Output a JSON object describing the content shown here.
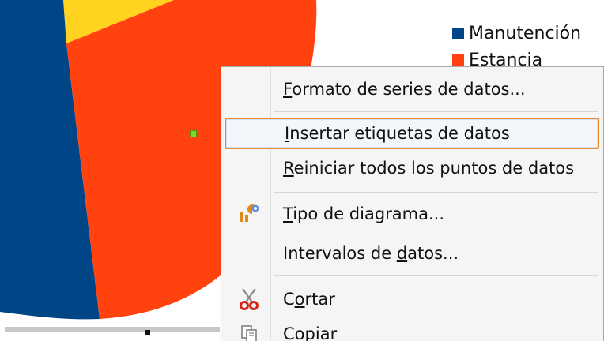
{
  "chart_data": {
    "type": "pie",
    "legend": {
      "placement": "top-right",
      "entries": [
        {
          "label": "Manutención",
          "color": "#004586"
        },
        {
          "label": "Estancia",
          "color": "#ff420e"
        }
      ]
    },
    "series_colors": {
      "Manutención": "#004586",
      "Estancia": "#ff420e",
      "other": "#ffd320"
    }
  },
  "context_menu": {
    "items": [
      {
        "key": "format_series",
        "pre": "",
        "ul": "F",
        "post": "ormato de series de datos...",
        "icon": ""
      },
      {
        "key": "insert_labels",
        "pre": "",
        "ul": "I",
        "post": "nsertar etiquetas de datos",
        "icon": "",
        "highlighted": true
      },
      {
        "key": "reset_points",
        "pre": "",
        "ul": "R",
        "post": "einiciar todos los puntos de datos",
        "icon": ""
      },
      {
        "key": "chart_type",
        "pre": "",
        "ul": "T",
        "post": "ipo de diagrama...",
        "icon": "chart-type-icon"
      },
      {
        "key": "data_ranges",
        "pre": "Intervalos de ",
        "ul": "d",
        "post": "atos...",
        "icon": ""
      },
      {
        "key": "cut",
        "pre": "C",
        "ul": "o",
        "post": "rtar",
        "icon": "scissors-icon"
      },
      {
        "key": "copy",
        "pre": "Co",
        "ul": "p",
        "post": "iar",
        "icon": "copy-icon"
      }
    ]
  },
  "colors": {
    "highlight_border": "#f08a2e",
    "menu_background": "#f5f5f5"
  }
}
